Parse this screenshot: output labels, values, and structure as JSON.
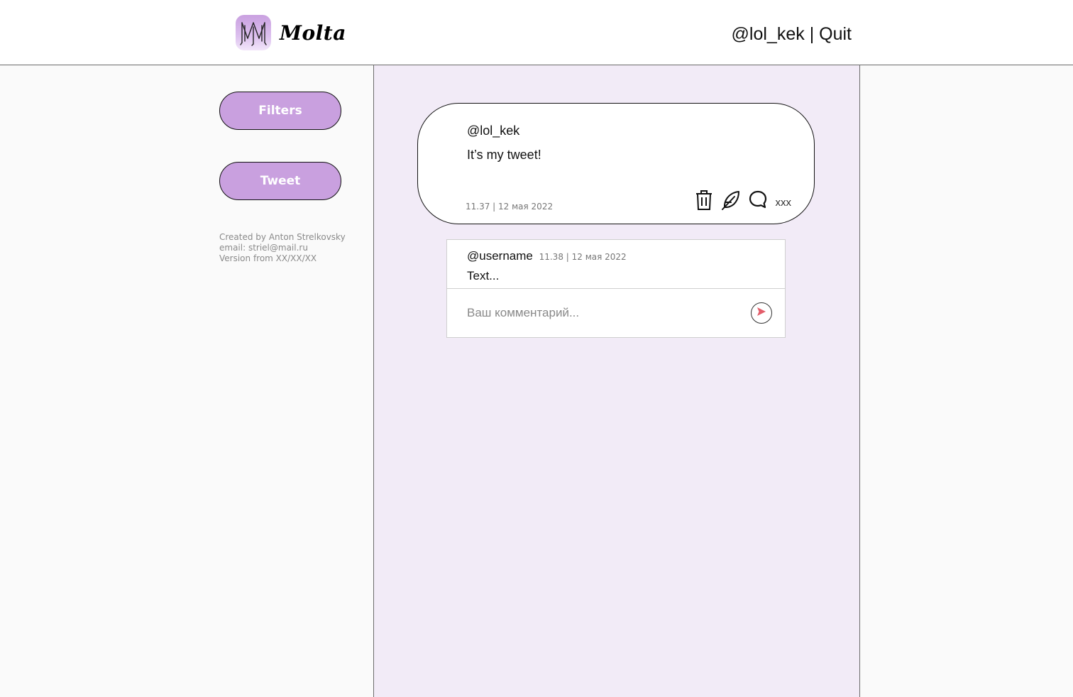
{
  "header": {
    "logo_name": "Molta",
    "username": "@lol_kek",
    "separator": "|",
    "quit_label": "Quit"
  },
  "sidebar": {
    "filters_label": "Filters",
    "tweet_label": "Tweet",
    "credits": [
      "Created by Anton Strelkovsky",
      "email: striel@mail.ru",
      "Version from XX/XX/XX"
    ]
  },
  "tweet": {
    "author": "@lol_kek",
    "text": "It’s my tweet!",
    "time": "11.37 | 12 мая 2022",
    "comment_count": "xxx",
    "icons": [
      "trash-icon",
      "feather-edit-icon",
      "comment-bubble-icon"
    ]
  },
  "comments": {
    "items": [
      {
        "author": "@username",
        "time": "11.38 | 12 мая 2022",
        "text": "Text..."
      }
    ],
    "input_placeholder": "Ваш комментарий...",
    "send_icon": "send-arrow-icon"
  },
  "colors": {
    "accent": "#c9a0df",
    "center_background": "#f2ebf7",
    "side_background": "#fafafa",
    "send_arrow": "#e35d6a"
  }
}
